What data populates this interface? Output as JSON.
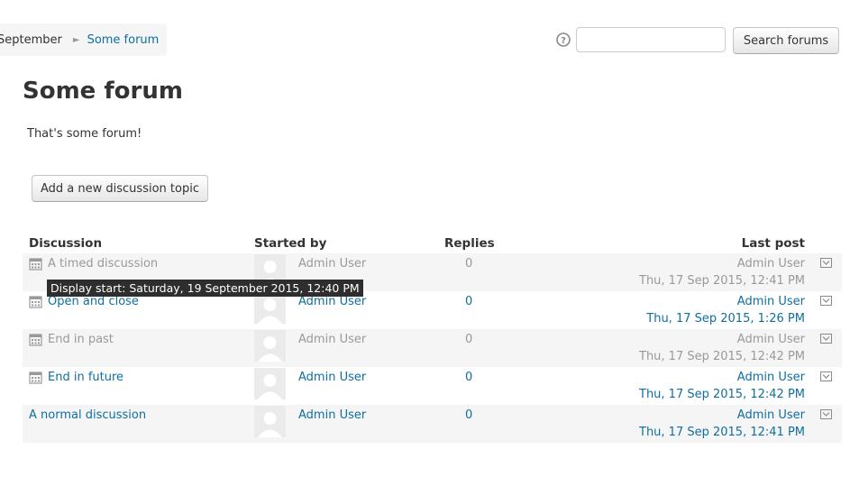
{
  "breadcrumb": {
    "items": [
      "September",
      "Some forum"
    ],
    "separator": "►"
  },
  "search": {
    "value": "",
    "placeholder": "",
    "button_label": "Search forums"
  },
  "page": {
    "title": "Some forum",
    "intro": "That's some forum!"
  },
  "actions": {
    "add_discussion_label": "Add a new discussion topic"
  },
  "table": {
    "headers": {
      "discussion": "Discussion",
      "started_by": "Started by",
      "replies": "Replies",
      "last_post": "Last post"
    },
    "rows": [
      {
        "title": "A timed discussion",
        "timed": true,
        "muted": true,
        "starter": "Admin User",
        "replies": "0",
        "last_user": "Admin User",
        "last_date": "Thu, 17 Sep 2015, 12:41 PM"
      },
      {
        "title": "Open and close",
        "timed": true,
        "muted": false,
        "starter": "Admin User",
        "replies": "0",
        "last_user": "Admin User",
        "last_date": "Thu, 17 Sep 2015, 1:26 PM"
      },
      {
        "title": "End in past",
        "timed": true,
        "muted": true,
        "starter": "Admin User",
        "replies": "0",
        "last_user": "Admin User",
        "last_date": "Thu, 17 Sep 2015, 12:42 PM"
      },
      {
        "title": "End in future",
        "timed": true,
        "muted": false,
        "starter": "Admin User",
        "replies": "0",
        "last_user": "Admin User",
        "last_date": "Thu, 17 Sep 2015, 12:42 PM"
      },
      {
        "title": "A normal discussion",
        "timed": false,
        "muted": false,
        "starter": "Admin User",
        "replies": "0",
        "last_user": "Admin User",
        "last_date": "Thu, 17 Sep 2015, 12:41 PM"
      }
    ]
  },
  "tooltip": {
    "text": "Display start: Saturday, 19 September 2015, 12:40 PM"
  },
  "colors": {
    "link": "#0f6e9f",
    "muted": "#999999",
    "row_stripe": "#f5f5f5",
    "tooltip_bg": "#2e2e2e"
  },
  "icons": {
    "help": "help-icon",
    "timed": "calendar-icon",
    "avatar": "user-avatar",
    "subscribe": "mail-icon"
  }
}
